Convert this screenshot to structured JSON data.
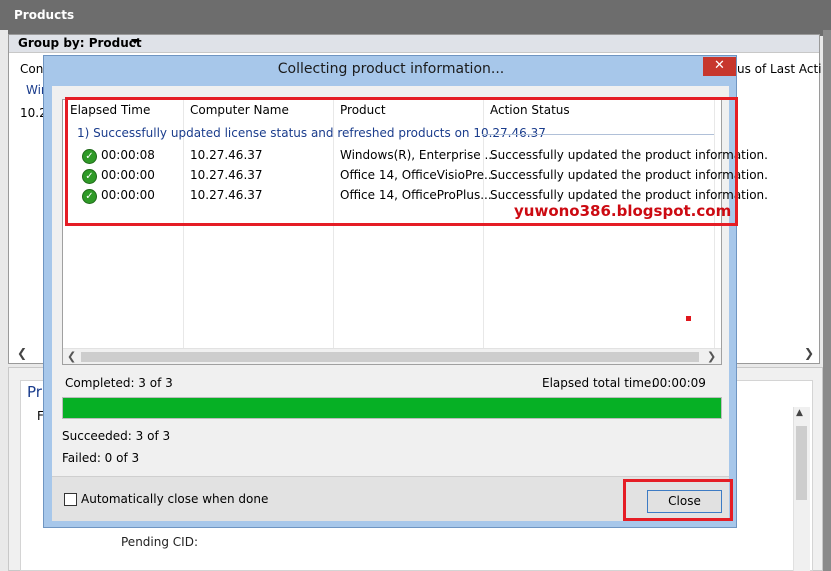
{
  "app": {
    "title": "Products",
    "group_by_label": "Group by: Product",
    "left_column_fragments": [
      "Con",
      "Win",
      "10.2"
    ],
    "right_column_fragment": "us of Last Acti",
    "lower_panel_fragments": [
      "Pr",
      "F"
    ],
    "pending_cid_label": "Pending CID:"
  },
  "dialog": {
    "title": "Collecting product information...",
    "close_glyph": "✕",
    "columns": [
      "Elapsed Time",
      "Computer Name",
      "Product",
      "Action Status"
    ],
    "group_header": "1) Successfully updated license status and refreshed products on 10.27.46.37",
    "rows": [
      {
        "elapsed": "00:00:08",
        "computer": "10.27.46.37",
        "product": "Windows(R), Enterprise ...",
        "status": "Successfully updated the product information."
      },
      {
        "elapsed": "00:00:00",
        "computer": "10.27.46.37",
        "product": "Office 14, OfficeVisioPre...",
        "status": "Successfully updated the product information."
      },
      {
        "elapsed": "00:00:00",
        "computer": "10.27.46.37",
        "product": "Office 14, OfficeProPlus...",
        "status": "Successfully updated the product information."
      }
    ],
    "watermark": "yuwono386.blogspot.com",
    "completed": "Completed: 3 of 3",
    "elapsed_total_label": "Elapsed total time:",
    "elapsed_total_value": "00:00:09",
    "progress_percent": 100,
    "succeeded": "Succeeded: 3 of 3",
    "failed": "Failed: 0 of 3",
    "auto_close_label": "Automatically close when done",
    "auto_close_checked": false,
    "close_button_label": "Close"
  },
  "colors": {
    "progress": "#06b025",
    "highlight_box": "#e51d25",
    "dialog_frame": "#a7c7ea",
    "success_icon": "#2f9a27"
  }
}
